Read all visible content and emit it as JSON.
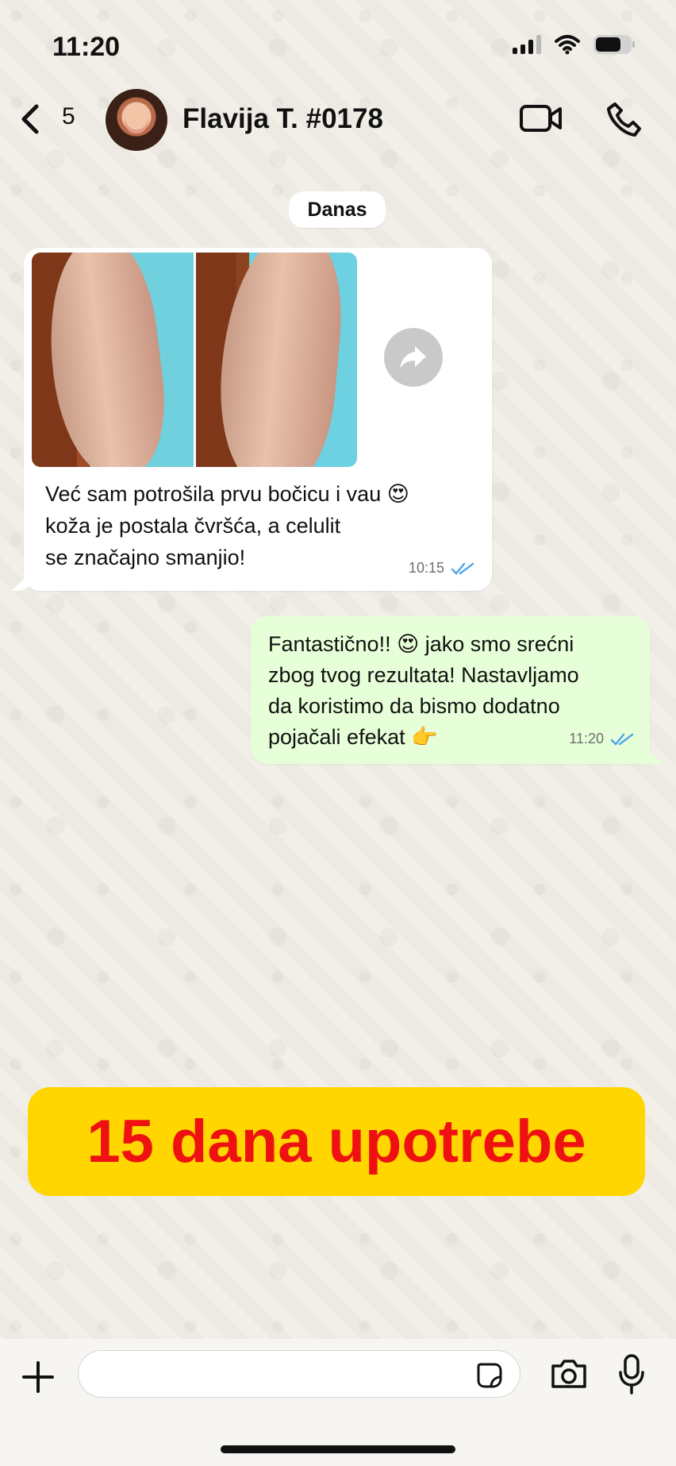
{
  "status_bar": {
    "time": "11:20"
  },
  "header": {
    "unread_count": "5",
    "contact_name": "Flavija T. #0178"
  },
  "date_separator": "Danas",
  "incoming_message": {
    "lines": [
      "Već sam potrošila prvu bočicu i vau 😍",
      "koža je postala čvršća, a celulit",
      "se značajno smanjio!"
    ],
    "time": "10:15"
  },
  "outgoing_message": {
    "lines": [
      "Fantastično!! 😍 jako smo srećni",
      "zbog tvog rezultata! Nastavljamo",
      "da koristimo da bismo dodatno",
      "pojačali efekat 👉"
    ],
    "time": "11:20"
  },
  "promo_banner": {
    "text": "15 dana upotrebe"
  },
  "composer": {
    "placeholder": ""
  },
  "colors": {
    "incoming_bubble": "#ffffff",
    "outgoing_bubble": "#e6ffd9",
    "promo_background": "#ffd600",
    "promo_text": "#ef1111",
    "read_ticks": "#53a6e8"
  },
  "icons": {
    "back": "chevron-left-icon",
    "video": "video-camera-icon",
    "phone": "phone-icon",
    "forward": "forward-arrow-icon",
    "plus": "plus-icon",
    "sticker": "sticker-icon",
    "camera": "camera-icon",
    "microphone": "microphone-icon"
  }
}
